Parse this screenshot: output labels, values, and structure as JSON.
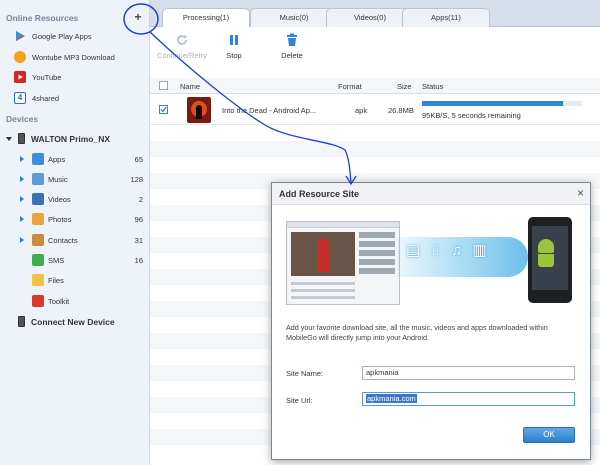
{
  "sidebar": {
    "online_heading": "Online Resources",
    "add_label": "+",
    "online_items": [
      {
        "label": "Google Play Apps",
        "icon": "play-store-icon"
      },
      {
        "label": "Wontube MP3 Download",
        "icon": "music-download-icon"
      },
      {
        "label": "YouTube",
        "icon": "youtube-icon"
      },
      {
        "label": "4shared",
        "icon": "4shared-icon"
      }
    ],
    "devices_heading": "Devices",
    "device_name": "WALTON Primo_NX",
    "device_items": [
      {
        "label": "Apps",
        "count": "65",
        "icon": "apps-icon"
      },
      {
        "label": "Music",
        "count": "128",
        "icon": "music-icon"
      },
      {
        "label": "Videos",
        "count": "2",
        "icon": "video-icon"
      },
      {
        "label": "Photos",
        "count": "96",
        "icon": "photos-icon"
      },
      {
        "label": "Contacts",
        "count": "31",
        "icon": "contacts-icon"
      },
      {
        "label": "SMS",
        "count": "16",
        "icon": "sms-icon"
      },
      {
        "label": "Files",
        "count": "",
        "icon": "folder-icon"
      },
      {
        "label": "Toolkit",
        "count": "",
        "icon": "toolkit-icon"
      }
    ],
    "connect_label": "Connect New Device"
  },
  "tabs": [
    {
      "label": "Processing(1)",
      "active": true
    },
    {
      "label": "Music(0)",
      "active": false
    },
    {
      "label": "Videos(0)",
      "active": false
    },
    {
      "label": "Apps(11)",
      "active": false
    }
  ],
  "toolbar": {
    "continue_label": "Continue/Retry",
    "stop_label": "Stop",
    "delete_label": "Delete"
  },
  "table": {
    "headers": {
      "name": "Name",
      "format": "Format",
      "size": "Size",
      "status": "Status"
    },
    "rows": [
      {
        "name": "Into the Dead - Android Ap...",
        "format": "apk",
        "size": "26.8MB",
        "status": "95KB/S, 5 seconds remaining",
        "progress": 0.88,
        "checked": true
      }
    ]
  },
  "dialog": {
    "title": "Add Resource Site",
    "close_label": "×",
    "description": "Add your favorite download site, all the music, videos and apps downloaded within MobileGo will directly jump into your Android.",
    "site_name_label": "Site Name:",
    "site_name_value": "apkmania",
    "site_url_label": "Site Url:",
    "site_url_value": "apkmania.com",
    "ok_label": "OK"
  },
  "colors": {
    "accent": "#2f86d6",
    "sidebar_bg": "#eef3f9",
    "annotation": "#1f3fd6"
  }
}
